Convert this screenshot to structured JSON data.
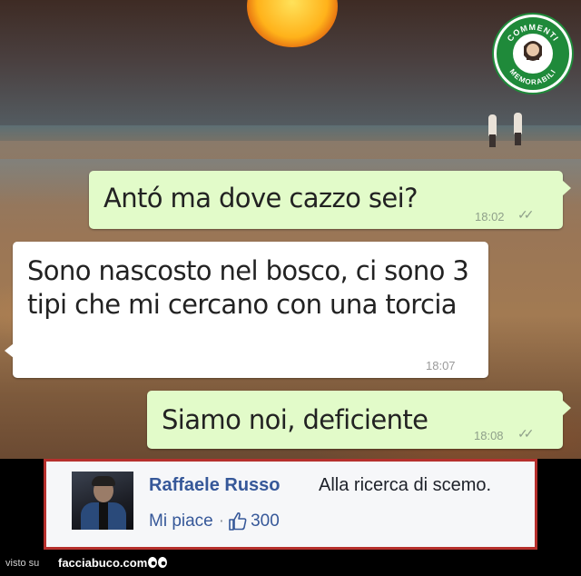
{
  "logo": {
    "text_top": "COMMENTI",
    "text_bottom": "MEMORABILI",
    "accent": "#1f8a3a"
  },
  "chat": {
    "messages": [
      {
        "direction": "outgoing",
        "text": "Antó ma dove cazzo sei?",
        "time": "18:02",
        "ticks": "✓✓"
      },
      {
        "direction": "incoming",
        "text": "Sono nascosto nel bosco,  ci sono 3 tipi che mi cercano con una torcia",
        "time": "18:07"
      },
      {
        "direction": "outgoing",
        "text": "Siamo noi, deficiente",
        "time": "18:08",
        "ticks": "✓✓"
      }
    ],
    "outgoing_color": "#e2fbc9",
    "incoming_color": "#ffffff"
  },
  "comment": {
    "author": "Raffaele Russo",
    "text": "Alla ricerca di scemo.",
    "like_label": "Mi piace",
    "separator": "·",
    "like_icon": "thumbs-up-icon",
    "like_count": "300",
    "border_color": "#b6302d",
    "name_color": "#365899"
  },
  "footer": {
    "visto_su": "visto su",
    "site": "facciabuco.com",
    "eyes_icon": "eyes-icon"
  }
}
